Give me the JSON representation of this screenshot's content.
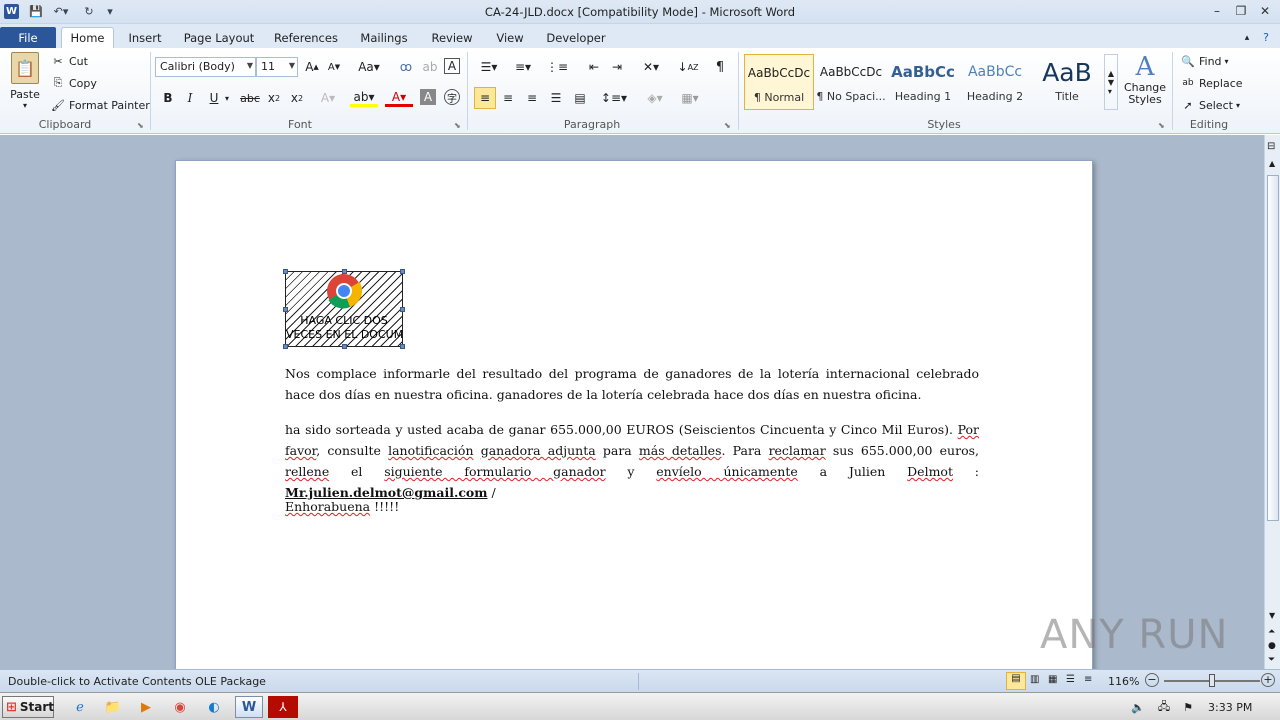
{
  "window": {
    "title": "CA-24-JLD.docx [Compatibility Mode] - Microsoft Word"
  },
  "tabs": [
    "File",
    "Home",
    "Insert",
    "Page Layout",
    "References",
    "Mailings",
    "Review",
    "View",
    "Developer"
  ],
  "clipboard": {
    "group": "Clipboard",
    "paste": "Paste",
    "cut": "Cut",
    "copy": "Copy",
    "format_painter": "Format Painter"
  },
  "font": {
    "group": "Font",
    "name": "Calibri (Body)",
    "size": "11"
  },
  "paragraph": {
    "group": "Paragraph"
  },
  "styles": {
    "group": "Styles",
    "items": [
      {
        "preview": "AaBbCcDc",
        "name": "¶ Normal"
      },
      {
        "preview": "AaBbCcDc",
        "name": "¶ No Spaci..."
      },
      {
        "preview": "AaBbCc",
        "name": "Heading 1"
      },
      {
        "preview": "AaBbCc",
        "name": "Heading 2"
      },
      {
        "preview": "AaB",
        "name": "Title"
      }
    ],
    "change_styles": "Change Styles"
  },
  "editing": {
    "group": "Editing",
    "find": "Find",
    "replace": "Replace",
    "select": "Select"
  },
  "document": {
    "ole_caption_1": "HAGA CLIC DOS",
    "ole_caption_2": "VECES EN EL DOCUM",
    "p1": "Nos complace informarle del resultado del programa de ganadores de la lotería internacional celebrado hace dos días en nuestra oficina. ganadores de la lotería celebrada hace dos días en nuestra oficina.",
    "p2_a": "ha sido sorteada y usted acaba de ganar 655.000,00 EUROS (Seiscientos Cincuenta y Cinco Mil Euros). ",
    "p2_por": "Por favor",
    "p2_b": ", consulte ",
    "p2_lanot": "lanotificación",
    "p2_c": " ",
    "p2_ganadora": "ganadora adjunta",
    "p2_d": " para ",
    "p2_mas": "más detalles",
    "p2_e": ". Para ",
    "p2_reclamar": "reclamar",
    "p2_f": " sus 655.000,00 euros, ",
    "p2_rellene": "rellene",
    "p2_g": " el ",
    "p2_sig": "siguiente formulario ganador",
    "p2_h": " y ",
    "p2_env": "envíelo únicamente",
    "p2_i": " a Julien ",
    "p2_del": "Delmot",
    "p2_j": " : ",
    "p2_email": "Mr.julien.delmot@gmail.com",
    "p2_k": " /",
    "p3_a": "Enhorabuena",
    "p3_b": " !!!!!"
  },
  "status": {
    "message": "Double-click to Activate Contents OLE Package",
    "zoom": "116%"
  },
  "taskbar": {
    "start": "Start",
    "clock": "3:33 PM"
  },
  "watermark": "ANY RUN"
}
